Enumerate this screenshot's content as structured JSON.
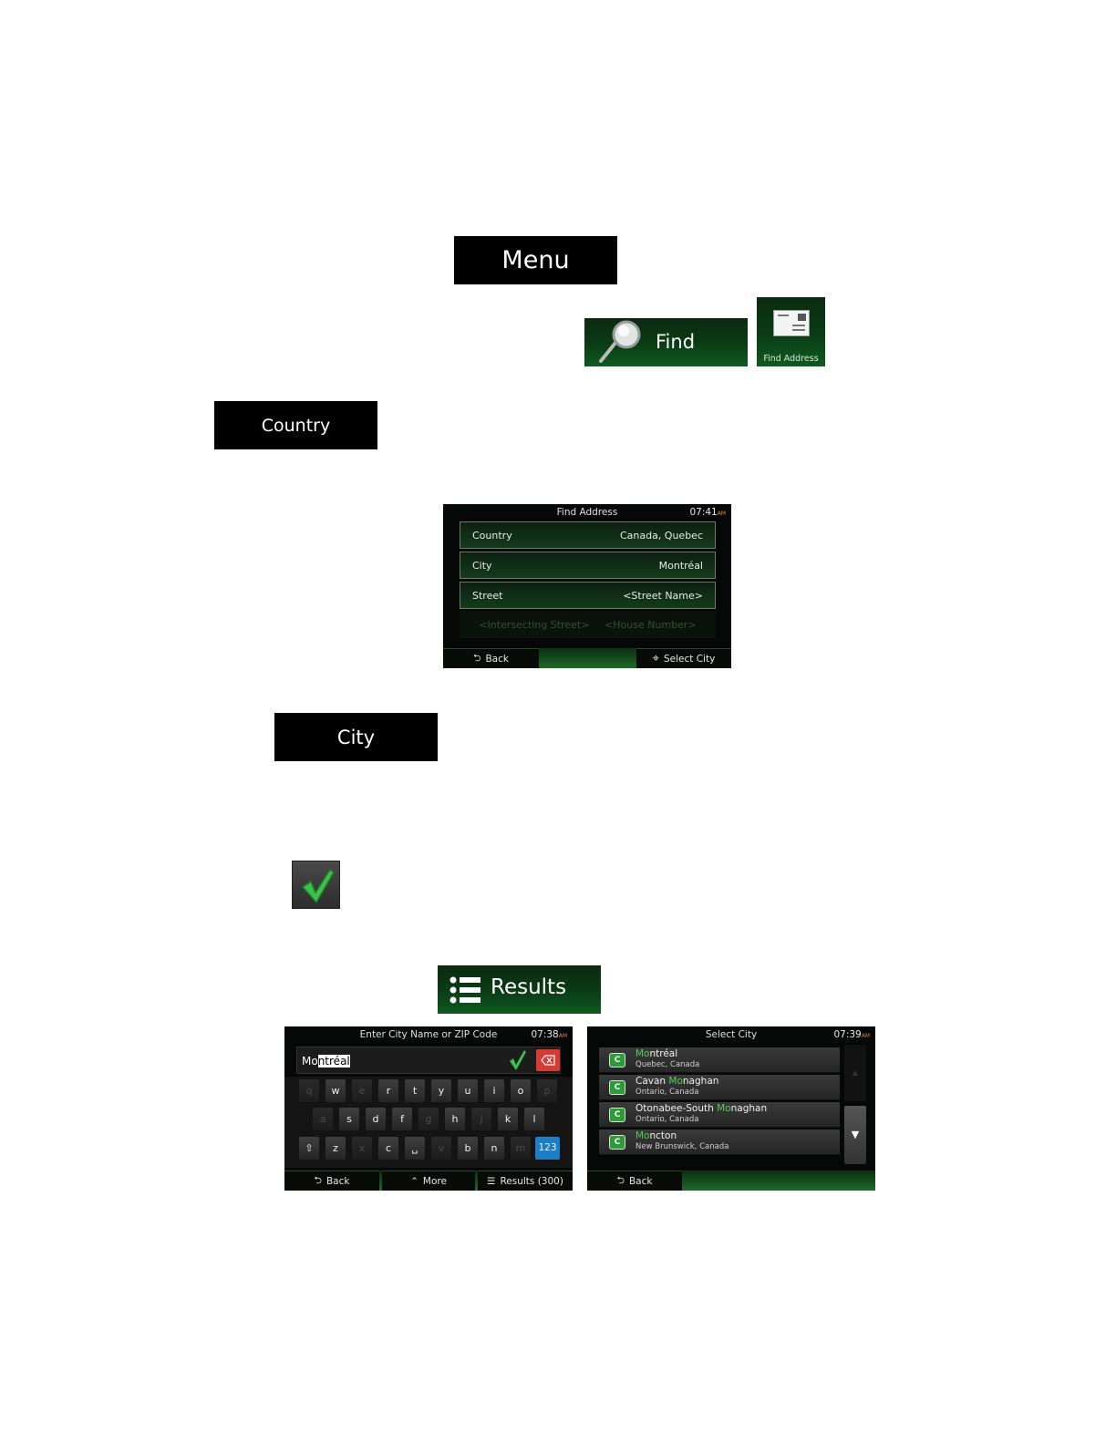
{
  "menu_label": "Menu",
  "find": {
    "label": "Find"
  },
  "find_address_icon": {
    "label": "Find Address"
  },
  "country_label": "Country",
  "city_label": "City",
  "results_label": "Results",
  "find_address_screen": {
    "title": "Find Address",
    "time": "07:41",
    "ampm": "AM",
    "rows": [
      {
        "label": "Country",
        "value": "Canada, Quebec"
      },
      {
        "label": "City",
        "value": "Montréal"
      },
      {
        "label": "Street",
        "value": "<Street Name>"
      }
    ],
    "disabled": [
      "<Intersecting Street>",
      "<House Number>"
    ],
    "back": "Back",
    "select_city": "Select City"
  },
  "keyboard_screen": {
    "title": "Enter City Name or ZIP Code",
    "time": "07:38",
    "ampm": "AM",
    "typed": "Mo",
    "autocomplete": "ntréal",
    "row1": [
      "q",
      "w",
      "e",
      "r",
      "t",
      "y",
      "u",
      "i",
      "o",
      "p"
    ],
    "row2": [
      "a",
      "s",
      "d",
      "f",
      "g",
      "h",
      "j",
      "k",
      "l"
    ],
    "row3": [
      "z",
      "x",
      "c",
      "v",
      "b",
      "n",
      "m"
    ],
    "numbers_key": "123",
    "back": "Back",
    "more": "More",
    "results": "Results (300)"
  },
  "select_city_screen": {
    "title": "Select City",
    "time": "07:39",
    "ampm": "AM",
    "cities": [
      {
        "pre": "",
        "match": "Mo",
        "post": "ntréal",
        "region": "Quebec, Canada"
      },
      {
        "pre": "Cavan ",
        "match": "Mo",
        "post": "naghan",
        "region": "Ontario, Canada"
      },
      {
        "pre": "Otonabee-South ",
        "match": "Mo",
        "post": "naghan",
        "region": "Ontario, Canada"
      },
      {
        "pre": "",
        "match": "Mo",
        "post": "ncton",
        "region": "New Brunswick, Canada"
      }
    ],
    "back": "Back"
  }
}
